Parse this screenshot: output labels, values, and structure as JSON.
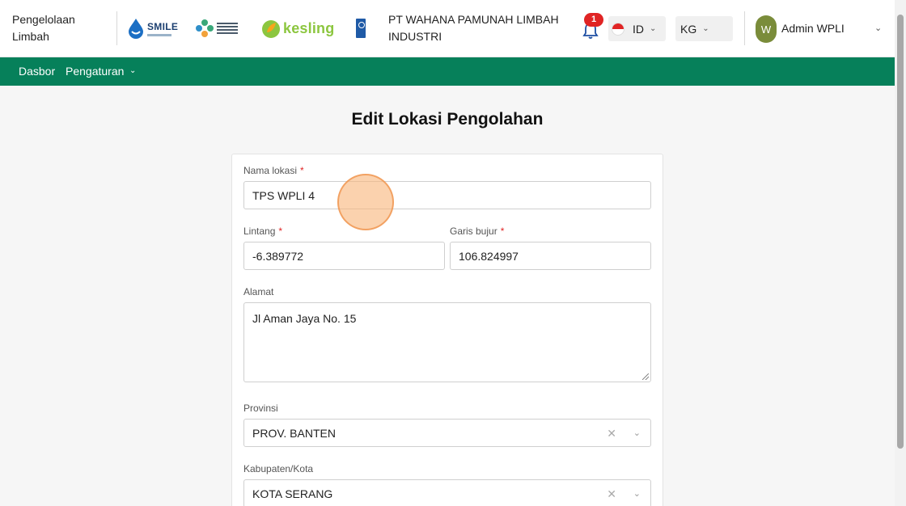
{
  "header": {
    "app_title": "Pengelolaan Limbah",
    "logos": {
      "smile": "SMILE",
      "kemenkes": "KEMENTERIAN KESEHATAN REPUBLIK INDONESIA",
      "kesling": "kesling",
      "undp": "UNDP"
    },
    "company_name": "PT WAHANA PAMUNAH LIMBAH INDUSTRI",
    "notification_count": "1",
    "language": "ID",
    "unit": "KG",
    "avatar_initial": "W",
    "username": "Admin WPLI"
  },
  "nav": {
    "dasbor": "Dasbor",
    "pengaturan": "Pengaturan"
  },
  "page": {
    "title": "Edit Lokasi Pengolahan"
  },
  "form": {
    "nama_lokasi": {
      "label": "Nama lokasi",
      "required": "*",
      "value": "TPS WPLI 4"
    },
    "lintang": {
      "label": "Lintang",
      "required": "*",
      "value": "-6.389772"
    },
    "garis_bujur": {
      "label": "Garis bujur",
      "required": "*",
      "value": "106.824997"
    },
    "alamat": {
      "label": "Alamat",
      "value": "Jl Aman Jaya No. 15"
    },
    "provinsi": {
      "label": "Provinsi",
      "value": "PROV. BANTEN"
    },
    "kabupaten": {
      "label": "Kabupaten/Kota",
      "value": "KOTA SERANG"
    }
  },
  "colors": {
    "brand_green": "#06805a",
    "badge_red": "#e02424",
    "avatar_olive": "#7a8c3a"
  },
  "icons": {
    "notification": "bell-icon",
    "language_flag": "indonesia-flag-icon",
    "dropdown": "chevron-down-icon",
    "clear": "close-icon"
  }
}
